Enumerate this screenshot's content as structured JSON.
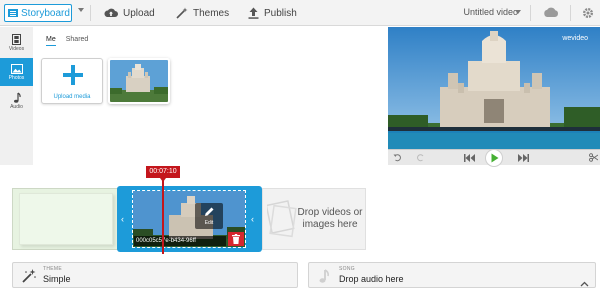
{
  "toolbar": {
    "storyboard_label": "Storyboard",
    "upload_label": "Upload",
    "themes_label": "Themes",
    "publish_label": "Publish",
    "video_title": "Untitled video"
  },
  "sidebar": {
    "items": [
      {
        "label": "Videos",
        "icon": "film-icon"
      },
      {
        "label": "Photos",
        "icon": "image-icon",
        "active": true
      },
      {
        "label": "Audio",
        "icon": "music-note-icon"
      }
    ]
  },
  "media": {
    "tabs": [
      {
        "label": "Me",
        "active": true
      },
      {
        "label": "Shared",
        "active": false
      }
    ],
    "upload_label": "Upload media"
  },
  "player": {
    "watermark": "wevideo"
  },
  "timeline": {
    "timestamp": "00:07:10",
    "edit_label": "Edit",
    "clip_name": "000c05c57e-b434-96ff",
    "drop_text": "Drop videos or images here"
  },
  "theme": {
    "small_label": "THEME",
    "value": "Simple"
  },
  "song": {
    "small_label": "SONG",
    "value": "Drop audio here"
  },
  "colors": {
    "accent": "#1d9bd9",
    "playhead": "#c4161c",
    "play_button": "#46b033",
    "delete": "#d6262e"
  }
}
